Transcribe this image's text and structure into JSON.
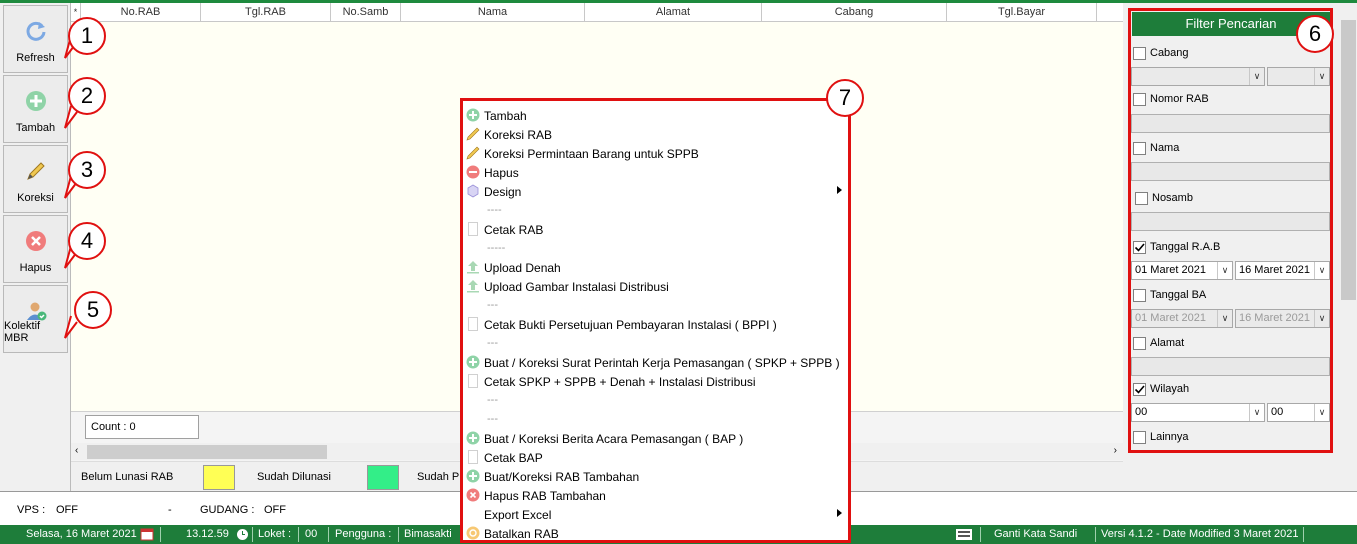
{
  "toolbar": {
    "refresh": "Refresh",
    "tambah": "Tambah",
    "koreksi": "Koreksi",
    "hapus": "Hapus",
    "kolektif": "Kolektif MBR"
  },
  "callouts": [
    "1",
    "2",
    "3",
    "4",
    "5",
    "6",
    "7"
  ],
  "grid": {
    "corner": "*",
    "columns": [
      "No.RAB",
      "Tgl.RAB",
      "No.Samb",
      "Nama",
      "Alamat",
      "Cabang",
      "Tgl.Bayar"
    ],
    "count": "Count : 0"
  },
  "legend": {
    "belum": "Belum Lunasi RAB",
    "sudah": "Sudah Dilunasi",
    "sudah_p": "Sudah Pr",
    "colors": {
      "belum": "#ffff55",
      "sudah": "#33ee88"
    }
  },
  "vps": {
    "vps_label": "VPS :",
    "vps_value": "OFF",
    "dash": "-",
    "gudang_label": "GUDANG :",
    "gudang_value": "OFF"
  },
  "status": {
    "date": "Selasa, 16 Maret 2021",
    "time": "13.12.59",
    "loket_label": "Loket :",
    "loket_value": "00",
    "pengguna_label": "Pengguna :",
    "pengguna_value": "Bimasakti",
    "ganti": "Ganti Kata Sandi",
    "versi": "Versi 4.1.2 - Date Modified 3 Maret 2021"
  },
  "filter": {
    "title": "Filter Pencarian",
    "cabang": {
      "label": "Cabang",
      "checked": false
    },
    "nomor_rab": {
      "label": "Nomor RAB",
      "checked": false
    },
    "nama": {
      "label": "Nama",
      "checked": false
    },
    "nosamb": {
      "label": "Nosamb",
      "checked": false
    },
    "tanggal_rab": {
      "label": "Tanggal R.A.B",
      "checked": true,
      "from": "01 Maret 2021",
      "to": "16 Maret 2021"
    },
    "tanggal_ba": {
      "label": "Tanggal BA",
      "checked": false,
      "from": "01 Maret 2021",
      "to": "16 Maret 2021"
    },
    "alamat": {
      "label": "Alamat",
      "checked": false
    },
    "wilayah": {
      "label": "Wilayah",
      "checked": true,
      "from": "00",
      "to": "00"
    },
    "lainnya": {
      "label": "Lainnya",
      "checked": false
    }
  },
  "menu": {
    "items": [
      {
        "label": "Tambah",
        "icon": "plus-circle-icon"
      },
      {
        "label": "Koreksi RAB",
        "icon": "pencil-icon"
      },
      {
        "label": "Koreksi Permintaan Barang untuk SPPB",
        "icon": "pencil-icon"
      },
      {
        "label": "Hapus",
        "icon": "minus-circle-icon"
      },
      {
        "label": "Design",
        "icon": "design-icon",
        "submenu": true
      },
      {
        "sep": "----"
      },
      {
        "label": "Cetak RAB",
        "icon": "document-icon"
      },
      {
        "sep": "-----"
      },
      {
        "label": "Upload Denah",
        "icon": "upload-icon"
      },
      {
        "label": "Upload Gambar Instalasi Distribusi",
        "icon": "upload-icon"
      },
      {
        "sep": "---"
      },
      {
        "label": "Cetak Bukti Persetujuan Pembayaran Instalasi ( BPPI )",
        "icon": "document-icon"
      },
      {
        "sep": "---"
      },
      {
        "label": "Buat / Koreksi Surat Perintah Kerja Pemasangan ( SPKP + SPPB )",
        "icon": "plus-circle-icon"
      },
      {
        "label": "Cetak SPKP + SPPB + Denah + Instalasi Distribusi",
        "icon": "document-icon"
      },
      {
        "sep": "---"
      },
      {
        "sep": "---"
      },
      {
        "label": "Buat / Koreksi Berita Acara Pemasangan ( BAP )",
        "icon": "plus-circle-icon"
      },
      {
        "label": "Cetak BAP",
        "icon": "document-icon"
      },
      {
        "label": "Buat/Koreksi RAB Tambahan",
        "icon": "plus-circle-icon"
      },
      {
        "label": "Hapus RAB Tambahan",
        "icon": "x-circle-icon"
      },
      {
        "label": "Export Excel",
        "icon": "none",
        "submenu": true
      },
      {
        "label": "Batalkan RAB",
        "icon": "cancel-icon"
      }
    ]
  }
}
